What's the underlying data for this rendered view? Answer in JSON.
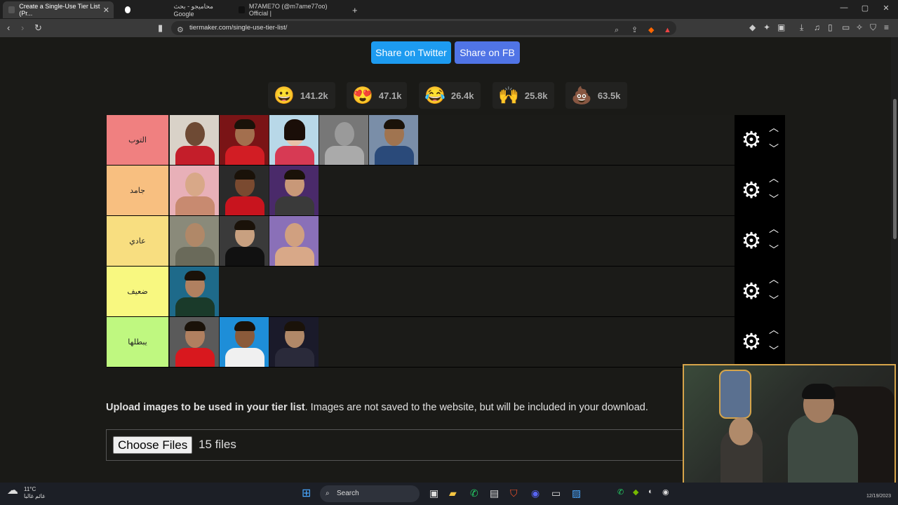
{
  "browser": {
    "tabs": [
      {
        "title": "Create a Single-Use Tier List (Pr...",
        "active": true
      },
      {
        "title": "محاميجو - بحث Google",
        "active": false
      },
      {
        "title": "M7AME7O (@m7ame77oo) Official |",
        "active": false
      }
    ],
    "new_tab": "+",
    "url": "tiermaker.com/single-use-tier-list/",
    "window_controls": [
      "—",
      "▢",
      "✕"
    ]
  },
  "share": {
    "twitter": "Share on Twitter",
    "facebook": "Share on FB"
  },
  "reactions": [
    {
      "emoji": "😀",
      "count": "141.2k"
    },
    {
      "emoji": "😍",
      "count": "47.1k"
    },
    {
      "emoji": "😂",
      "count": "26.4k"
    },
    {
      "emoji": "🙌",
      "count": "25.8k"
    },
    {
      "emoji": "💩",
      "count": "63.5k"
    }
  ],
  "tiers": [
    {
      "label": "التوب",
      "color": "#f08080",
      "items": 5
    },
    {
      "label": "جامد",
      "color": "#f8bf80",
      "items": 3
    },
    {
      "label": "عادي",
      "color": "#f8de80",
      "items": 3
    },
    {
      "label": "ضعيف",
      "color": "#f8f880",
      "items": 1
    },
    {
      "label": "يبطلها",
      "color": "#bff880",
      "items": 3
    }
  ],
  "upload": {
    "bold": "Upload images to be used in your tier list",
    "rest": ". Images are not saved to the website, but will be included in your download.",
    "button": "Choose Files",
    "file_count": "15 files"
  },
  "taskbar": {
    "weather_temp": "11°C",
    "weather_desc": "غائم غالبا",
    "search": "Search",
    "date": "12/19/2023"
  },
  "icons": [
    "gear-icon",
    "chevron-up-icon",
    "chevron-down-icon",
    "search-icon",
    "windows-start-icon"
  ]
}
